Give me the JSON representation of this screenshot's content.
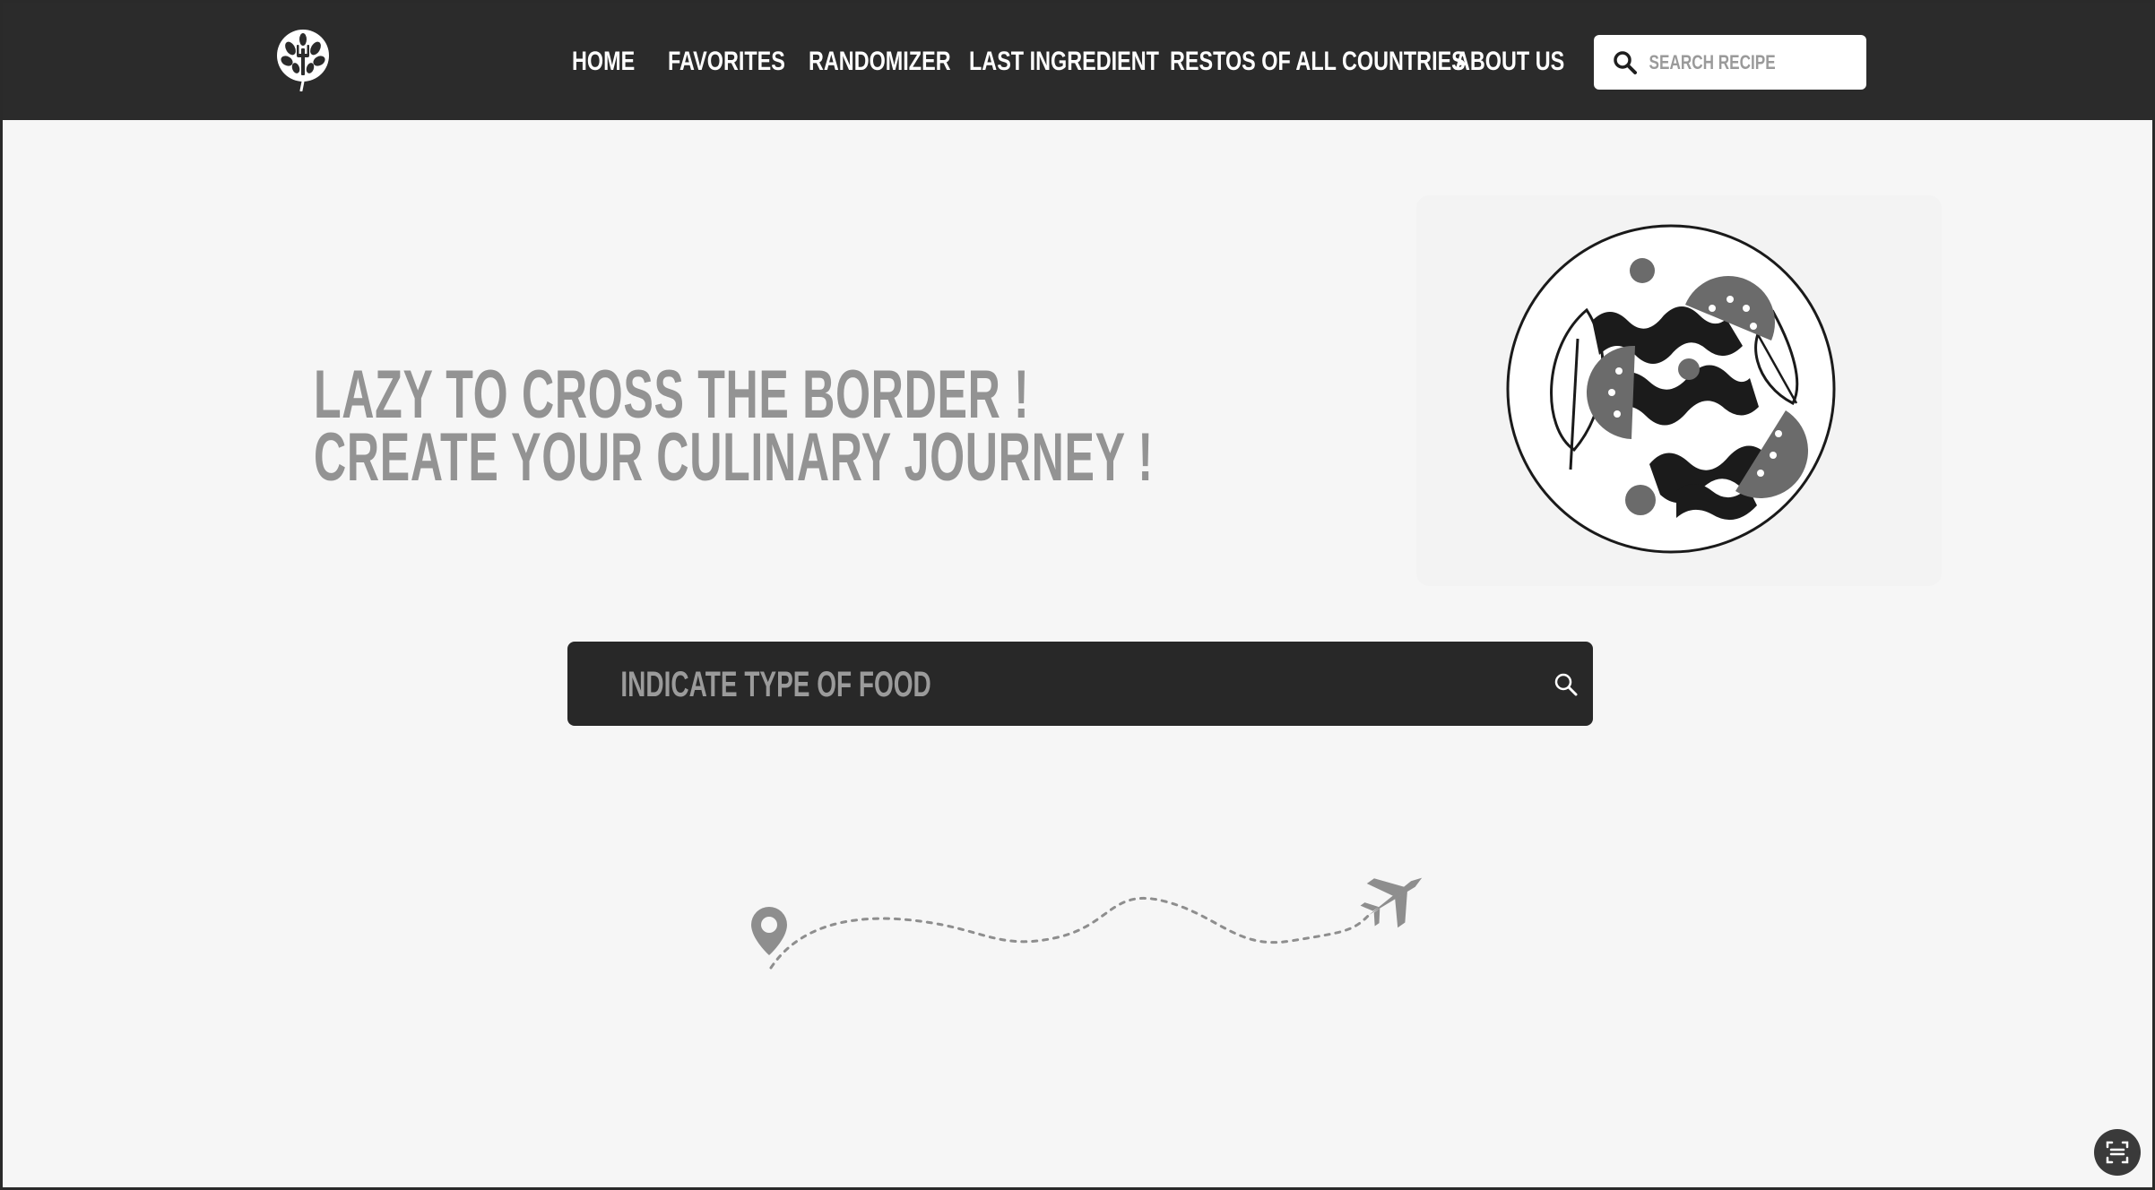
{
  "header": {
    "nav": [
      {
        "id": "home",
        "label": "HOME"
      },
      {
        "id": "favorites",
        "label": "FAVORITES"
      },
      {
        "id": "randomizer",
        "label": "RANDOMIZER"
      },
      {
        "id": "last-ingredient",
        "label": "LAST INGREDIENT"
      },
      {
        "id": "restos",
        "label": "RESTOS OF ALL COUNTRIES"
      },
      {
        "id": "about",
        "label": "ABOUT US"
      }
    ],
    "search": {
      "placeholder": "SEARCH RECIPE",
      "value": ""
    }
  },
  "hero": {
    "line1": "LAZY TO CROSS THE BORDER !",
    "line2": "CREATE YOUR CULINARY JOURNEY !"
  },
  "food_search": {
    "placeholder": "INDICATE TYPE OF FOOD",
    "value": ""
  },
  "colors": {
    "header_bg": "#2b2b2b",
    "page_bg": "#f6f6f6",
    "hero_text": "#939393",
    "search_bar_bg": "#282828"
  },
  "icons": {
    "logo": "tree-leaf-fork-icon",
    "header_search": "search-icon",
    "food_search": "search-icon",
    "journey_start": "map-pin-icon",
    "journey_end": "airplane-icon",
    "fab": "scan-icon"
  }
}
